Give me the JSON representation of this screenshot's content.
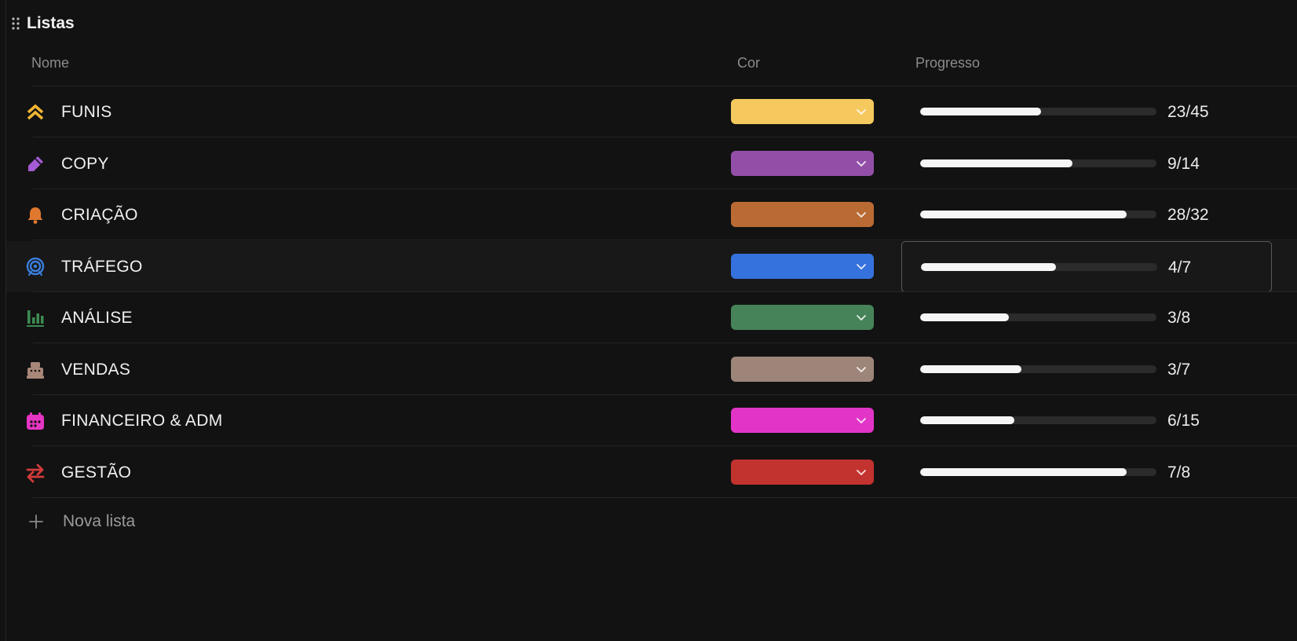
{
  "header": {
    "title": "Listas"
  },
  "columns": {
    "name": "Nome",
    "color": "Cor",
    "progress": "Progresso"
  },
  "rows": [
    {
      "name": "FUNIS",
      "icon": "chevrons-up-icon",
      "icon_color": "#f2b533",
      "color": "#f5c95e",
      "progress_text": "23/45",
      "done": 23,
      "total": 45
    },
    {
      "name": "COPY",
      "icon": "pencil-icon",
      "icon_color": "#a55bd6",
      "color": "#934fa8",
      "progress_text": "9/14",
      "done": 9,
      "total": 14
    },
    {
      "name": "CRIAÇÃO",
      "icon": "bell-icon",
      "icon_color": "#e0782f",
      "color": "#b96b33",
      "progress_text": "28/32",
      "done": 28,
      "total": 32
    },
    {
      "name": "TRÁFEGO",
      "icon": "target-icon",
      "icon_color": "#3b7fe0",
      "color": "#3672dd",
      "progress_text": "4/7",
      "done": 4,
      "total": 7
    },
    {
      "name": "ANÁLISE",
      "icon": "bar-chart-icon",
      "icon_color": "#3e8c52",
      "color": "#468358",
      "progress_text": "3/8",
      "done": 3,
      "total": 8
    },
    {
      "name": "VENDAS",
      "icon": "cash-register-icon",
      "icon_color": "#a8877a",
      "color": "#9d8579",
      "progress_text": "3/7",
      "done": 3,
      "total": 7
    },
    {
      "name": "FINANCEIRO & ADM",
      "icon": "calendar-icon",
      "icon_color": "#e535c2",
      "color": "#e235c7",
      "progress_text": "6/15",
      "done": 6,
      "total": 15
    },
    {
      "name": "GESTÃO",
      "icon": "arrows-swap-icon",
      "icon_color": "#d23b3b",
      "color": "#c23330",
      "progress_text": "7/8",
      "done": 7,
      "total": 8
    }
  ],
  "new_list": {
    "label": "Nova lista"
  }
}
